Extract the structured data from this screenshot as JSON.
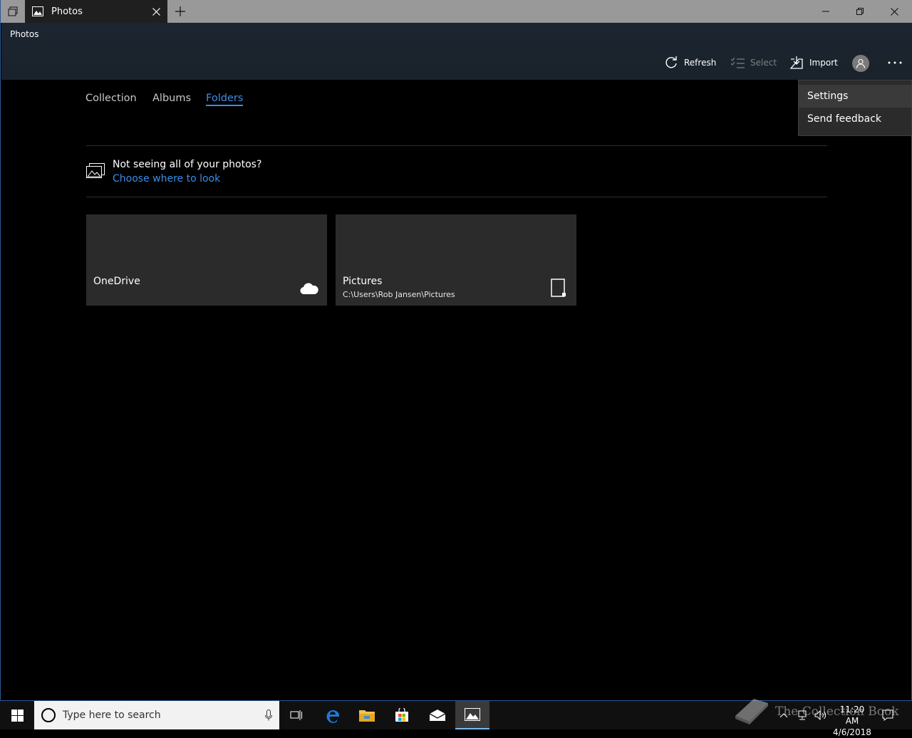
{
  "window": {
    "tab_title": "Photos",
    "app_name": "Photos"
  },
  "commands": {
    "refresh": "Refresh",
    "select": "Select",
    "import": "Import"
  },
  "nav": {
    "tabs": [
      {
        "label": "Collection",
        "active": false
      },
      {
        "label": "Albums",
        "active": false
      },
      {
        "label": "Folders",
        "active": true
      }
    ]
  },
  "hint": {
    "text": "Not seeing all of your photos?",
    "link": "Choose where to look"
  },
  "folders": [
    {
      "title": "OneDrive",
      "subtitle": "",
      "icon": "cloud-icon"
    },
    {
      "title": "Pictures",
      "subtitle": "C:\\Users\\Rob Jansen\\Pictures",
      "icon": "device-icon"
    }
  ],
  "menu": {
    "items": [
      "Settings",
      "Send feedback"
    ]
  },
  "taskbar": {
    "search_placeholder": "Type here to search",
    "time": "11:20 AM",
    "date": "4/6/2018"
  },
  "watermark": {
    "text": "The Collection Book"
  },
  "colors": {
    "accent": "#3c8ce7",
    "header_bg": "#1c2530",
    "tile_bg": "#2b2b2b",
    "titlebar": "#999999"
  }
}
